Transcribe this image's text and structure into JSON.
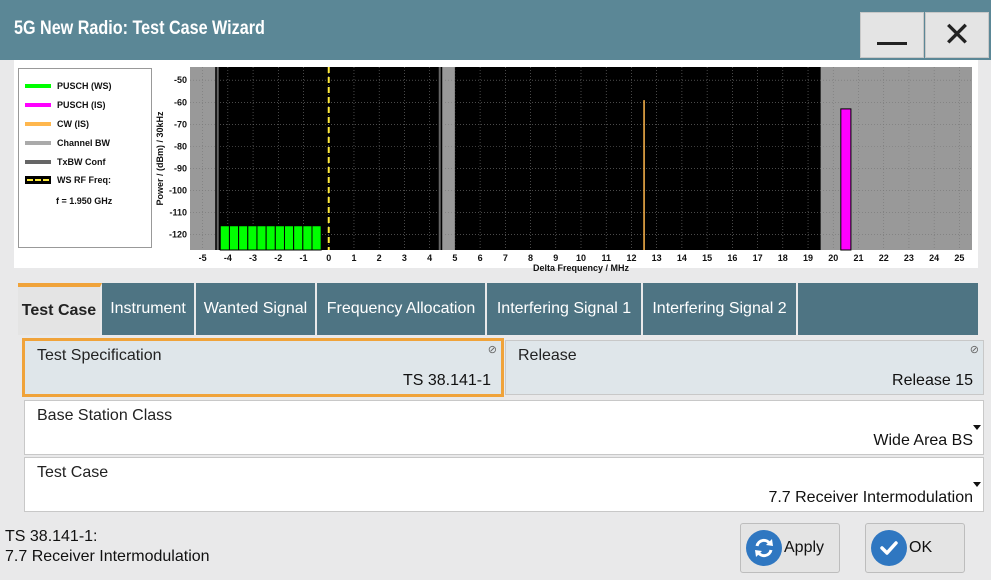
{
  "window": {
    "title": "5G New Radio: Test Case Wizard",
    "minimize_icon": "minimize-icon",
    "close_icon": "close-icon"
  },
  "chart_data": {
    "type": "bar",
    "title": "",
    "xlabel": "Delta Frequency / MHz",
    "ylabel": "Power / (dBm) / 30kHz",
    "xlim": [
      -5.5,
      25.5
    ],
    "ylim": [
      -127,
      -44
    ],
    "x_ticks": [
      "-5",
      "-4",
      "-3",
      "-2",
      "-1",
      "0",
      "1",
      "2",
      "3",
      "4",
      "5",
      "6",
      "7",
      "8",
      "9",
      "10",
      "11",
      "12",
      "13",
      "14",
      "15",
      "16",
      "17",
      "18",
      "19",
      "20",
      "21",
      "22",
      "23",
      "24",
      "25"
    ],
    "y_ticks": [
      "-50",
      "-60",
      "-70",
      "-80",
      "-90",
      "-100",
      "-110",
      "-120"
    ],
    "grid": true,
    "legend": {
      "position": "left",
      "entries": [
        {
          "name": "PUSCH (WS)",
          "color": "#00ff00",
          "style": "solid"
        },
        {
          "name": "PUSCH (IS)",
          "color": "#ff00ff",
          "style": "solid"
        },
        {
          "name": "CW (IS)",
          "color": "#ffb74d",
          "style": "solid"
        },
        {
          "name": "Channel BW",
          "color": "#aaaaaa",
          "style": "solid"
        },
        {
          "name": "TxBW Conf",
          "color": "#666666",
          "style": "solid"
        },
        {
          "name": "WS RF Freq:",
          "color": "#ffeb3b",
          "style": "dashed"
        }
      ],
      "ws_rf_freq": "f = 1.950 GHz"
    },
    "channel_bw_ranges": [
      [
        -5.5,
        -4.5
      ],
      [
        4.5,
        5.0
      ],
      [
        19.5,
        25.5
      ]
    ],
    "txbw_lines": [
      -4.4,
      4.4
    ],
    "ws_rf_line": 0,
    "cw_is_line": {
      "x": 12.5,
      "top": -59
    },
    "series": [
      {
        "name": "PUSCH (WS)",
        "color": "#00ff00",
        "x_start": -4.3,
        "x_end": -0.3,
        "blocks": 11,
        "value": -116
      },
      {
        "name": "PUSCH (IS)",
        "color": "#ff00ff",
        "x_start": 20.3,
        "x_end": 20.7,
        "blocks": 1,
        "value": -63
      }
    ]
  },
  "tabs": [
    {
      "label": "Test Case",
      "active": true
    },
    {
      "label": "Instrument",
      "active": false
    },
    {
      "label": "Wanted Signal",
      "active": false
    },
    {
      "label": "Frequency Allocation",
      "active": false
    },
    {
      "label": "Interfering Signal 1",
      "active": false
    },
    {
      "label": "Interfering Signal 2",
      "active": false
    }
  ],
  "fields": {
    "test_spec": {
      "label": "Test Specification",
      "value": "TS 38.141-1"
    },
    "release": {
      "label": "Release",
      "value": "Release 15"
    },
    "bs_class": {
      "label": "Base Station Class",
      "value": "Wide Area BS"
    },
    "test_case": {
      "label": "Test Case",
      "value": "7.7 Receiver Intermodulation"
    }
  },
  "status": {
    "line1": "TS 38.141-1:",
    "line2": "7.7 Receiver Intermodulation"
  },
  "buttons": {
    "apply": "Apply",
    "ok": "OK"
  }
}
